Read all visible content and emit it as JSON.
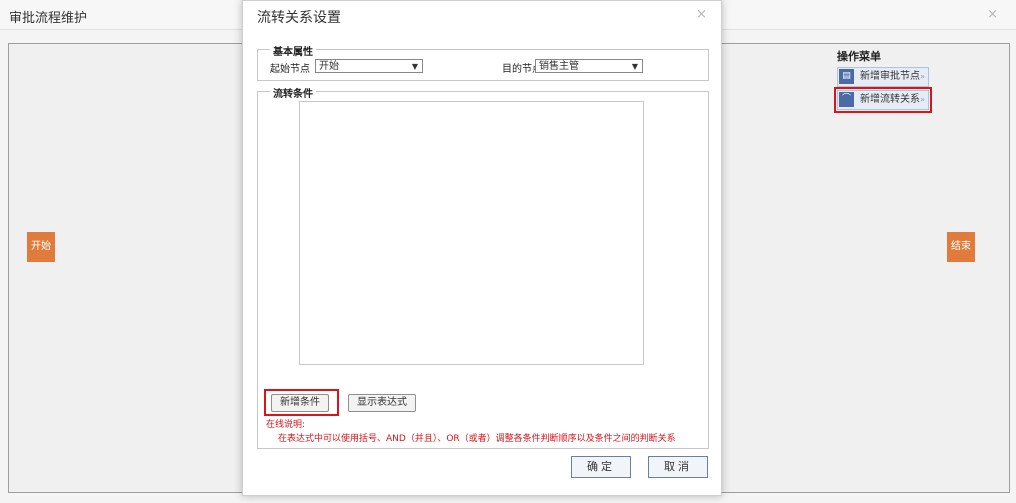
{
  "background": {
    "title": "审批流程维护",
    "close": "×",
    "nodes": {
      "start": "开始",
      "end": "结束"
    },
    "op_menu": {
      "title": "操作菜单",
      "items": [
        {
          "label": "新增审批节点",
          "icon": "add-node-icon",
          "arrow": "»"
        },
        {
          "label": "新增流转关系",
          "icon": "link-icon",
          "arrow": "»"
        }
      ]
    }
  },
  "dialog": {
    "title": "流转关系设置",
    "close": "×",
    "basic": {
      "legend": "基本属性",
      "start_label": "起始节点",
      "start_value": "开始",
      "target_label": "目的节点",
      "target_value": "销售主管"
    },
    "condition": {
      "legend": "流转条件",
      "add_button": "新增条件",
      "show_button": "显示表达式",
      "note_title": "在线说明:",
      "note_text": "在表达式中可以使用括号、AND（并且）、OR（或者）调整各条件判断顺序以及条件之间的判断关系"
    },
    "confirm": "确定",
    "cancel": "取消"
  },
  "colors": {
    "node": "#e07b3c",
    "highlight": "#d9141b",
    "note": "#d9141b"
  }
}
